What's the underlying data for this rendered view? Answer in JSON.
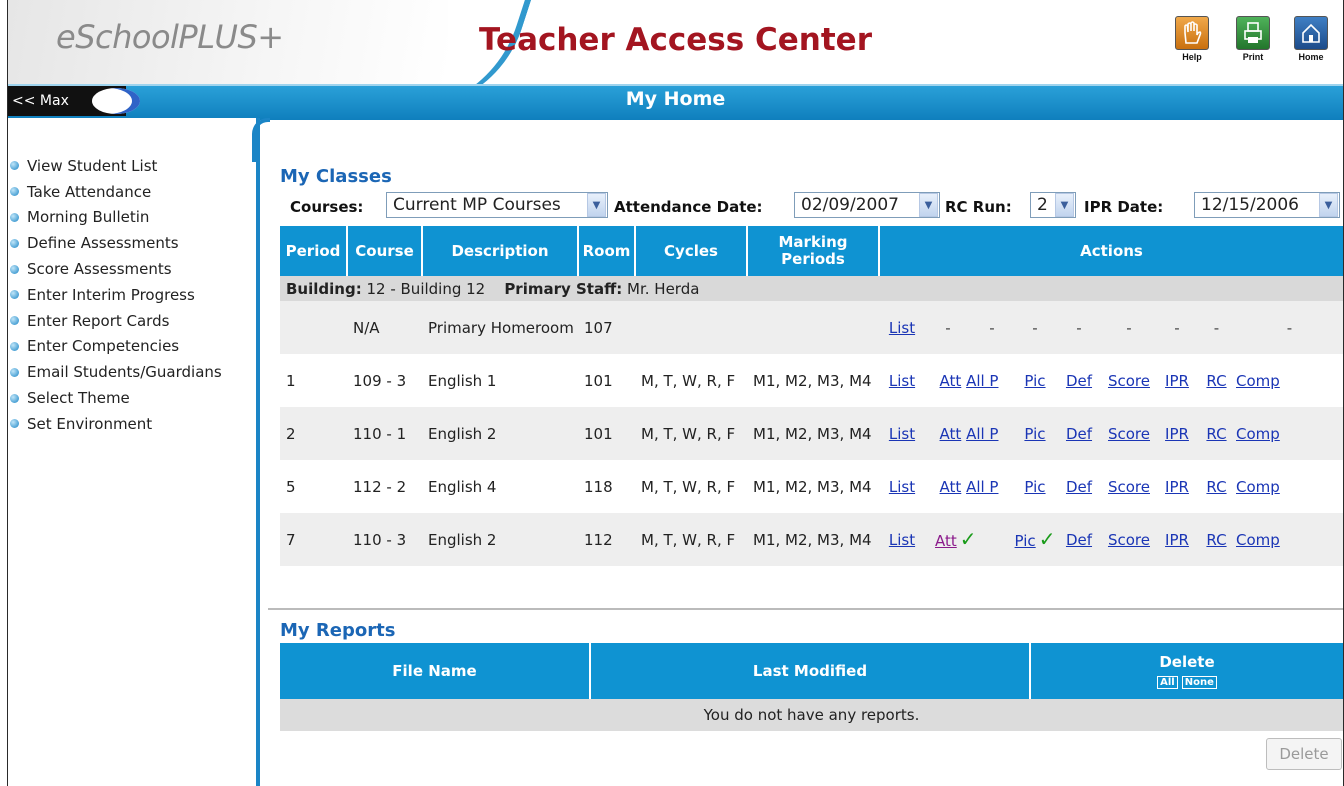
{
  "header": {
    "logo": "eSchoolPLUS+",
    "app_title": "Teacher Access Center",
    "buttons": [
      {
        "label": "Help",
        "icon": "hand-icon",
        "color": "#e08a20"
      },
      {
        "label": "Print",
        "icon": "printer-icon",
        "color": "#2f8a3a"
      },
      {
        "label": "Home",
        "icon": "house-icon",
        "color": "#2a5da0"
      }
    ]
  },
  "titlebar": {
    "max_label": "<< Max",
    "page_title": "My Home"
  },
  "sidebar": {
    "items": [
      "View Student List",
      "Take Attendance",
      "Morning Bulletin",
      "Define Assessments",
      "Score Assessments",
      "Enter Interim Progress",
      "Enter Report Cards",
      "Enter Competencies",
      "Email Students/Guardians",
      "Select Theme",
      "Set Environment"
    ]
  },
  "classes": {
    "title": "My Classes",
    "filters": {
      "courses_label": "Courses:",
      "courses_value": "Current MP Courses",
      "att_date_label": "Attendance Date:",
      "att_date_value": "02/09/2007",
      "rc_run_label": "RC Run:",
      "rc_run_value": "2",
      "ipr_date_label": "IPR Date:",
      "ipr_date_value": "12/15/2006"
    },
    "columns": {
      "period": "Period",
      "course": "Course",
      "description": "Description",
      "room": "Room",
      "cycles": "Cycles",
      "marking_periods": "Marking Periods",
      "actions": "Actions"
    },
    "building": {
      "building_label": "Building:",
      "building_value": "12 - Building 12",
      "staff_label": "Primary Staff:",
      "staff_value": "Mr. Herda"
    },
    "homeroom": {
      "period": "",
      "course": "N/A",
      "description": "Primary Homeroom",
      "room": "107",
      "cycles": "",
      "marking_periods": "",
      "list": "List",
      "dash": "-"
    },
    "rows": [
      {
        "period": "1",
        "course": "109 - 3",
        "description": "English 1",
        "room": "101",
        "cycles": "M, T, W, R, F",
        "marking_periods": "M1, M2, M3, M4",
        "list": "List",
        "att": "Att",
        "allp": "All P",
        "pic": "Pic",
        "def": "Def",
        "score": "Score",
        "ipr": "IPR",
        "rc": "RC",
        "comp": "Comp"
      },
      {
        "period": "2",
        "course": "110 - 1",
        "description": "English 2",
        "room": "101",
        "cycles": "M, T, W, R, F",
        "marking_periods": "M1, M2, M3, M4",
        "list": "List",
        "att": "Att",
        "allp": "All P",
        "pic": "Pic",
        "def": "Def",
        "score": "Score",
        "ipr": "IPR",
        "rc": "RC",
        "comp": "Comp"
      },
      {
        "period": "5",
        "course": "112 - 2",
        "description": "English 4",
        "room": "118",
        "cycles": "M, T, W, R, F",
        "marking_periods": "M1, M2, M3, M4",
        "list": "List",
        "att": "Att",
        "allp": "All P",
        "pic": "Pic",
        "def": "Def",
        "score": "Score",
        "ipr": "IPR",
        "rc": "RC",
        "comp": "Comp"
      },
      {
        "period": "7",
        "course": "110 - 3",
        "description": "English 2",
        "room": "112",
        "cycles": "M, T, W, R, F",
        "marking_periods": "M1, M2, M3, M4",
        "list": "List",
        "att": "Att",
        "allp": "",
        "pic": "Pic",
        "def": "Def",
        "score": "Score",
        "ipr": "IPR",
        "rc": "RC",
        "comp": "Comp",
        "att_check": "✓",
        "pic_check": "✓"
      }
    ]
  },
  "reports": {
    "title": "My Reports",
    "columns": {
      "file_name": "File Name",
      "last_modified": "Last Modified",
      "delete": "Delete",
      "all": "All",
      "none": "None"
    },
    "empty_message": "You do not have any reports.",
    "delete_button": "Delete"
  }
}
